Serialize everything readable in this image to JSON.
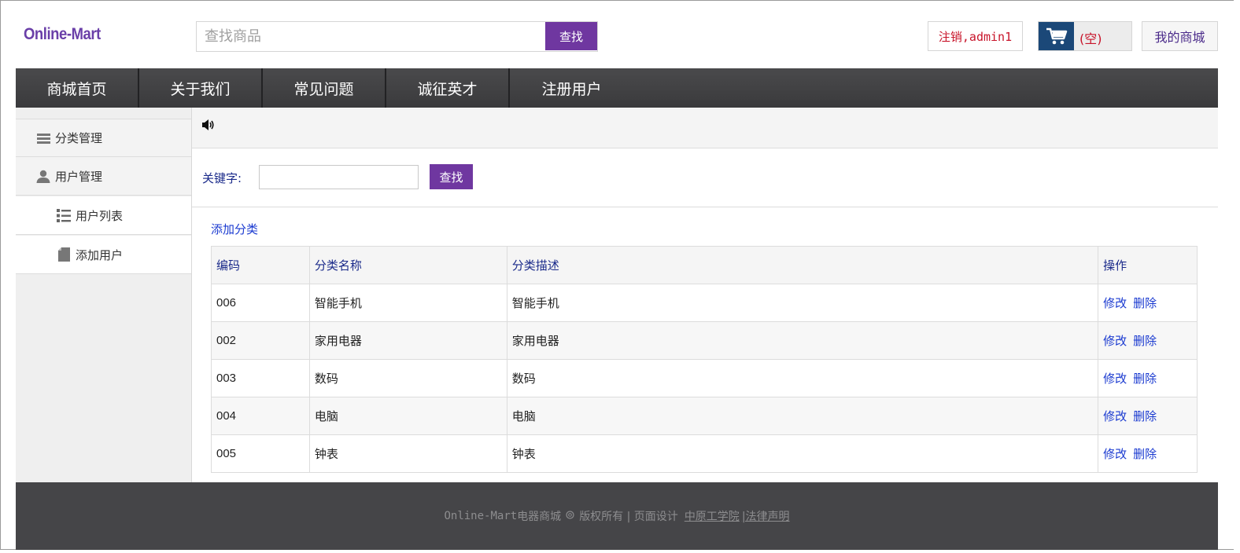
{
  "header": {
    "logo": "Online-Mart",
    "search_placeholder": "查找商品",
    "search_button": "查找",
    "logout_label": "注销,admin1",
    "cart_label": "(空)",
    "my_mall_label": "我的商城"
  },
  "nav": {
    "items": [
      "商城首页",
      "关于我们",
      "常见问题",
      "诚征英才",
      "注册用户"
    ]
  },
  "sidebar": {
    "items": [
      {
        "label": "分类管理",
        "icon": "list-bars-icon",
        "level": 1
      },
      {
        "label": "用户管理",
        "icon": "user-icon",
        "level": 1
      },
      {
        "label": "用户列表",
        "icon": "bullet-list-icon",
        "level": 2
      },
      {
        "label": "添加用户",
        "icon": "document-icon",
        "level": 2
      }
    ]
  },
  "filter": {
    "label": "关键字:",
    "button": "查找"
  },
  "actions": {
    "add_category": "添加分类"
  },
  "table": {
    "headers": [
      "编码",
      "分类名称",
      "分类描述",
      "操作"
    ],
    "rows": [
      {
        "code": "006",
        "name": "智能手机",
        "desc": "智能手机"
      },
      {
        "code": "002",
        "name": "家用电器",
        "desc": "家用电器"
      },
      {
        "code": "003",
        "name": "数码",
        "desc": "数码"
      },
      {
        "code": "004",
        "name": "电脑",
        "desc": "电脑"
      },
      {
        "code": "005",
        "name": "钟表",
        "desc": "钟表"
      }
    ],
    "edit_label": "修改",
    "delete_label": "删除"
  },
  "footer": {
    "brand": "Online-Mart",
    "text1": "电器商城",
    "text2": "版权所有 | 页面设计",
    "school": "中原工学院",
    "legal": "|法律声明"
  },
  "colors": {
    "accent": "#6f37a0",
    "nav_bg": "#3f3f41",
    "link": "#1a3ad0",
    "danger": "#c8142a"
  }
}
